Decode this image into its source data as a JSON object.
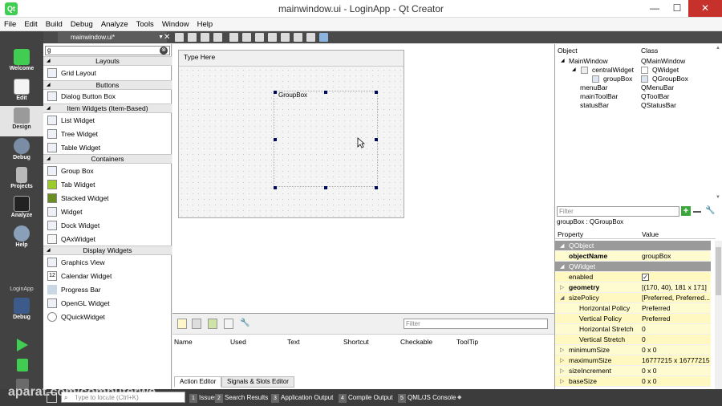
{
  "window": {
    "title": "mainwindow.ui - LoginApp - Qt Creator",
    "app_icon": "Qt",
    "min": "—",
    "max": "☐",
    "close": "✕"
  },
  "menu": [
    "File",
    "Edit",
    "Build",
    "Debug",
    "Analyze",
    "Tools",
    "Window",
    "Help"
  ],
  "modes": {
    "welcome": "Welcome",
    "edit": "Edit",
    "design": "Design",
    "debug": "Debug",
    "projects": "Projects",
    "analyze": "Analyze",
    "help": "Help",
    "kit_project": "LoginApp",
    "kit_mode": "Debug"
  },
  "doc_tab": "mainwindow.ui*",
  "widget_box": {
    "filter_value": "g",
    "filter_clear": "⊗",
    "categories": {
      "layouts": "Layouts",
      "buttons": "Buttons",
      "item_widgets": "Item Widgets (Item-Based)",
      "containers": "Containers",
      "display": "Display Widgets"
    },
    "items": {
      "grid_layout": "Grid Layout",
      "dialog_button_box": "Dialog Button Box",
      "list_widget": "List Widget",
      "tree_widget": "Tree Widget",
      "table_widget": "Table Widget",
      "group_box": "Group Box",
      "tab_widget": "Tab Widget",
      "stacked_widget": "Stacked Widget",
      "widget": "Widget",
      "dock_widget": "Dock Widget",
      "qaxwidget": "QAxWidget",
      "graphics_view": "Graphics View",
      "calendar_widget": "Calendar Widget",
      "progress_bar": "Progress Bar",
      "opengl_widget": "OpenGL Widget",
      "qquickwidget": "QQuickWidget"
    }
  },
  "form": {
    "menu_placeholder": "Type Here",
    "groupbox_title": "GroupBox"
  },
  "action_editor": {
    "filter_placeholder": "Filter",
    "columns": {
      "name": "Name",
      "used": "Used",
      "text": "Text",
      "shortcut": "Shortcut",
      "checkable": "Checkable",
      "tooltip": "ToolTip"
    },
    "tabs": {
      "action": "Action Editor",
      "signals": "Signals & Slots Editor"
    }
  },
  "object_inspector": {
    "col_object": "Object",
    "col_class": "Class",
    "rows": {
      "r0": {
        "obj": "MainWindow",
        "cls": "QMainWindow"
      },
      "r1": {
        "obj": "centralWidget",
        "cls": "QWidget"
      },
      "r2": {
        "obj": "groupBox",
        "cls": "QGroupBox"
      },
      "r3": {
        "obj": "menuBar",
        "cls": "QMenuBar"
      },
      "r4": {
        "obj": "mainToolBar",
        "cls": "QToolBar"
      },
      "r5": {
        "obj": "statusBar",
        "cls": "QStatusBar"
      }
    }
  },
  "property_editor": {
    "filter_placeholder": "Filter",
    "selection": "groupBox : QGroupBox",
    "col_property": "Property",
    "col_value": "Value",
    "rows": {
      "qobject": "QObject",
      "object_name": {
        "n": "objectName",
        "v": "groupBox"
      },
      "qwidget": "QWidget",
      "enabled": {
        "n": "enabled",
        "v": "✓"
      },
      "geometry": {
        "n": "geometry",
        "v": "[(170, 40), 181 x 171]"
      },
      "size_policy": {
        "n": "sizePolicy",
        "v": "[Preferred, Preferred..."
      },
      "h_policy": {
        "n": "Horizontal Policy",
        "v": "Preferred"
      },
      "v_policy": {
        "n": "Vertical Policy",
        "v": "Preferred"
      },
      "h_stretch": {
        "n": "Horizontal Stretch",
        "v": "0"
      },
      "v_stretch": {
        "n": "Vertical Stretch",
        "v": "0"
      },
      "min_size": {
        "n": "minimumSize",
        "v": "0 x 0"
      },
      "max_size": {
        "n": "maximumSize",
        "v": "16777215 x 16777215"
      },
      "size_inc": {
        "n": "sizeIncrement",
        "v": "0 x 0"
      },
      "base_size": {
        "n": "baseSize",
        "v": "0 x 0"
      }
    }
  },
  "statusbar": {
    "locate_placeholder": "Type to locate (Ctrl+K)",
    "panes": {
      "p1": {
        "num": "1",
        "label": "Issues"
      },
      "p2": {
        "num": "2",
        "label": "Search Results"
      },
      "p3": {
        "num": "3",
        "label": "Application Output"
      },
      "p4": {
        "num": "4",
        "label": "Compile Output"
      },
      "p5": {
        "num": "5",
        "label": "QML/JS Console"
      }
    }
  },
  "watermark": "aparat.com/computerwe"
}
